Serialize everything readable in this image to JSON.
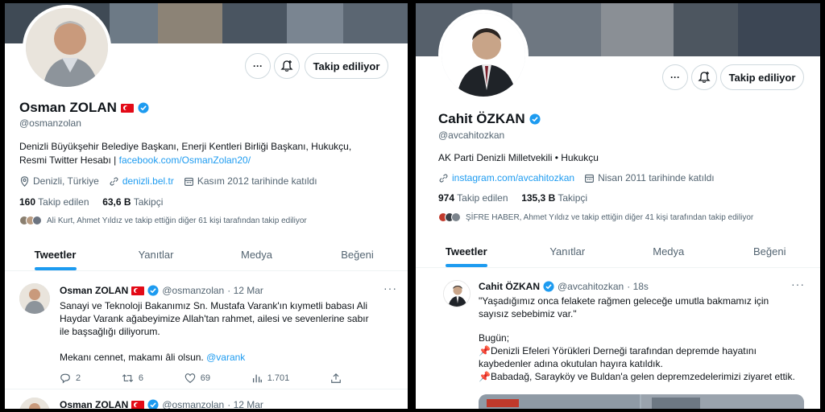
{
  "left": {
    "name": "Osman ZOLAN",
    "handle": "@osmanzolan",
    "more_label": "···",
    "follow_label": "Takip ediliyor",
    "bio_line1": "Denizli Büyükşehir Belediye Başkanı, Enerji Kentleri Birliği Başkanı, Hukukçu,",
    "bio_line2_prefix": "Resmi Twitter Hesabı | ",
    "bio_link": "facebook.com/OsmanZolan20/",
    "location": "Denizli, Türkiye",
    "website": "denizli.bel.tr",
    "joined": "Kasım 2012 tarihinde katıldı",
    "following_count": "160",
    "following_label": "Takip edilen",
    "followers_count": "63,6 B",
    "followers_label": "Takipçi",
    "known_followers": "Ali Kurt, Ahmet Yıldız ve takip ettiğin diğer 61 kişi tarafından takip ediliyor",
    "tabs": [
      "Tweetler",
      "Yanıtlar",
      "Medya",
      "Beğeni"
    ],
    "tweet1": {
      "name": "Osman ZOLAN",
      "handle": "@osmanzolan",
      "time": "· 12 Mar",
      "text_l1": "Sanayi ve Teknoloji Bakanımız Sn. Mustafa Varank'ın kıymetli babası Ali",
      "text_l2": "Haydar Varank ağabeyimize Allah'tan rahmet, ailesi ve sevenlerine sabır",
      "text_l3": "ile başsağlığı diliyorum.",
      "text_l4": "Mekanı cennet, makamı âli olsun. ",
      "mention": "@varank",
      "replies": "2",
      "retweets": "6",
      "likes": "69",
      "views": "1.701"
    },
    "tweet2": {
      "name": "Osman ZOLAN",
      "handle": "@osmanzolan",
      "time": "· 12 Mar"
    }
  },
  "right": {
    "name": "Cahit ÖZKAN",
    "handle": "@avcahitozkan",
    "more_label": "···",
    "follow_label": "Takip ediliyor",
    "bio": "AK Parti Denizli Milletvekili • Hukukçu",
    "website": "instagram.com/avcahitozkan",
    "joined": "Nisan 2011 tarihinde katıldı",
    "following_count": "974",
    "following_label": "Takip edilen",
    "followers_count": "135,3 B",
    "followers_label": "Takipçi",
    "known_followers": "ŞİFRE HABER, Ahmet Yıldız ve takip ettiğin diğer 41 kişi tarafından takip ediliyor",
    "tabs": [
      "Tweetler",
      "Yanıtlar",
      "Medya",
      "Beğeni"
    ],
    "tweet1": {
      "name": "Cahit ÖZKAN",
      "handle": "@avcahitozkan",
      "time": "· 18s",
      "text_l1": "\"Yaşadığımız onca felakete rağmen geleceğe umutla bakmamız için",
      "text_l2": "sayısız sebebimiz var.\"",
      "text_l3": "Bugün;",
      "text_l4": "Denizli Efeleri Yörükleri Derneği tarafından depremde hayatını",
      "text_l5": "kaybedenler adına okutulan hayıra katıldık.",
      "text_l6": "Babadağ, Sarayköy ve Buldan'a gelen depremzedelerimizi ziyaret ettik."
    }
  },
  "colors": {
    "accent": "#1d9bf0",
    "secondary_text": "#536471",
    "flag_red": "#e30a17"
  }
}
